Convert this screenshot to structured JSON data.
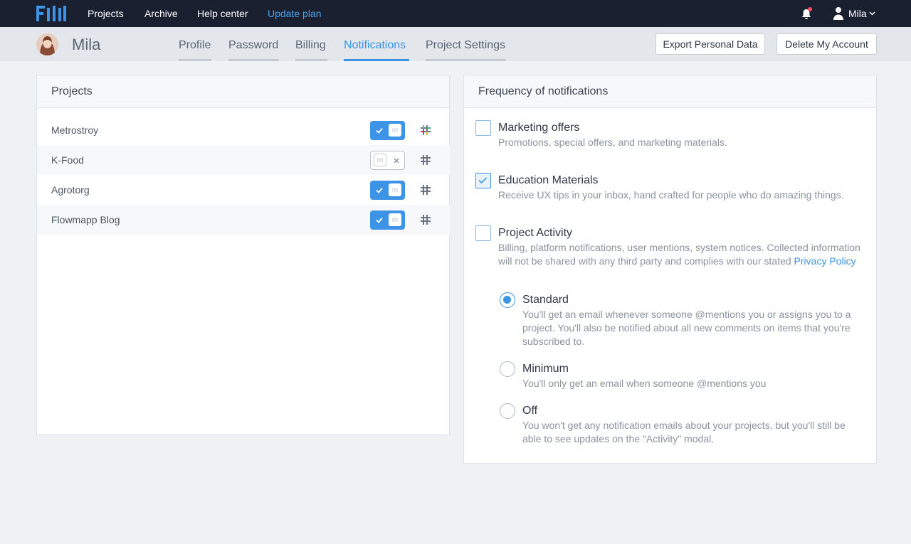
{
  "topnav": {
    "links": [
      "Projects",
      "Archive",
      "Help center"
    ],
    "update_plan": "Update plan",
    "user_name": "Mila"
  },
  "subheader": {
    "name": "Mila",
    "tabs": [
      "Profile",
      "Password",
      "Billing",
      "Notifications",
      "Project Settings"
    ],
    "active_tab": "Notifications",
    "export_button": "Export Personal Data",
    "delete_button": "Delete My Account"
  },
  "projects_panel": {
    "title": "Projects",
    "items": [
      {
        "name": "Metrostroy",
        "enabled": true
      },
      {
        "name": "K-Food",
        "enabled": false
      },
      {
        "name": "Agrotorg",
        "enabled": true
      },
      {
        "name": "Flowmapp Blog",
        "enabled": true
      }
    ]
  },
  "notifications_panel": {
    "title": "Frequency of notifications",
    "options": [
      {
        "title": "Marketing offers",
        "desc": "Promotions, special offers, and marketing materials.",
        "checked": false
      },
      {
        "title": "Education Materials",
        "desc": "Receive UX tips in your inbox, hand crafted for people who do amazing things.",
        "checked": true
      },
      {
        "title": "Project Activity",
        "desc": "Billing, platform notifications, user mentions, system notices. Collected information will not be shared with any third party and complies with our stated",
        "link": "Privacy Policy",
        "checked": false
      }
    ],
    "frequency": [
      {
        "title": "Standard",
        "desc": "You'll get an email whenever someone @mentions you or assigns you to a project. You'll also be notified about all new comments on items that you're subscribed to.",
        "selected": true
      },
      {
        "title": "Minimum",
        "desc": "You'll only get an email when someone @mentions you",
        "selected": false
      },
      {
        "title": "Off",
        "desc": "You won't get any notification emails about your projects, but you'll still be able to see updates on the \"Activity\" modal.",
        "selected": false
      }
    ]
  },
  "colors": {
    "accent": "#3d94e6",
    "topbar": "#1b2030",
    "notification_dot": "#ff4d5e"
  }
}
